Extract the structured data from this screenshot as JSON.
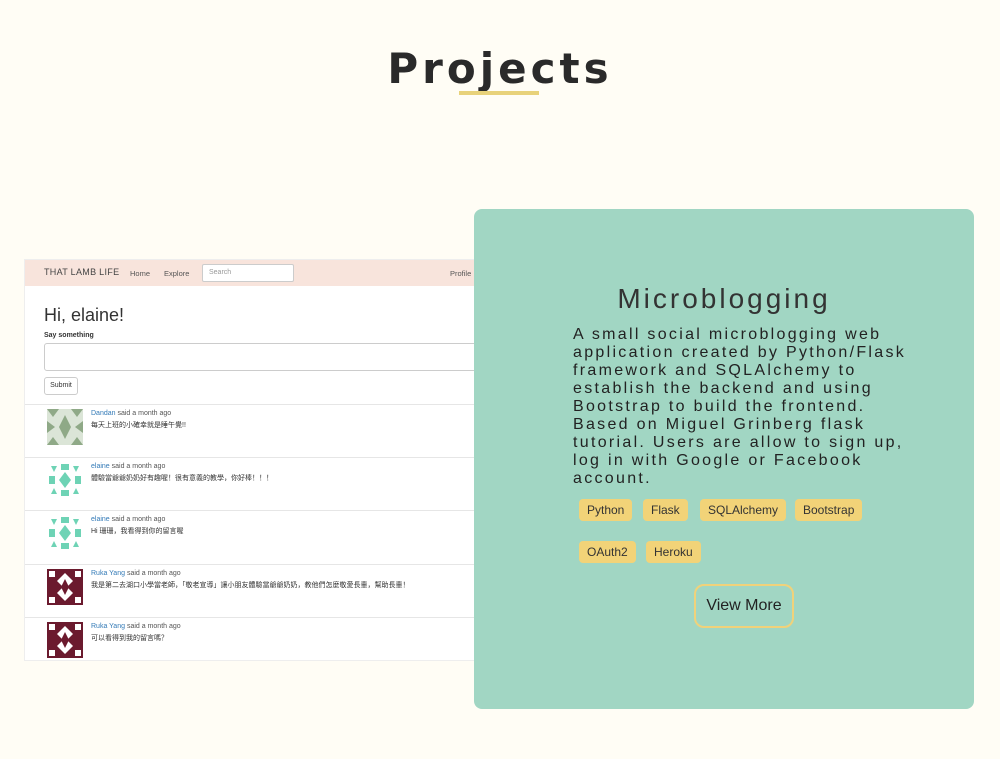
{
  "section": {
    "title": "Projects"
  },
  "screenshot": {
    "brand": "THAT LAMB LIFE",
    "nav": [
      "Home",
      "Explore"
    ],
    "search_placeholder": "Search",
    "profile": "Profile",
    "greeting": "Hi, elaine!",
    "say_label": "Say something",
    "submit": "Submit",
    "posts": [
      {
        "author": "Dandan",
        "time": "said a month ago",
        "body": "每天上班的小確幸就是睡午覺!!",
        "avatar_color": "#8fa987"
      },
      {
        "author": "elaine",
        "time": "said a month ago",
        "body": "體驗當爺爺奶奶好有趣喔！很有意義的教學，你好棒！！！",
        "avatar_color": "#6ed3b5"
      },
      {
        "author": "elaine",
        "time": "said a month ago",
        "body": "Hi 珊珊，我看得到你的留言喔",
        "avatar_color": "#6ed3b5"
      },
      {
        "author": "Ruka Yang",
        "time": "said a month ago",
        "body": "我是第二去湖口小學當老師，「敬老宣導」讓小朋友體驗當爺爺奶奶，教他們怎麼敬愛長輩，幫助長輩！",
        "avatar_color": "#6b1a2e"
      },
      {
        "author": "Ruka Yang",
        "time": "said a month ago",
        "body": "可以看得到我的留言嗎？",
        "avatar_color": "#6b1a2e"
      }
    ]
  },
  "card": {
    "title": "Microblogging",
    "description": "A small social microblogging web application created by Python/Flask framework and SQLAlchemy to establish the backend and using Bootstrap to build the frontend. Based on Miguel Grinberg flask tutorial. Users are allow to sign up, log in with Google or Facebook account.",
    "tags": [
      "Python",
      "Flask",
      "SQLAlchemy",
      "Bootstrap",
      "OAuth2",
      "Heroku"
    ],
    "button": "View More"
  }
}
